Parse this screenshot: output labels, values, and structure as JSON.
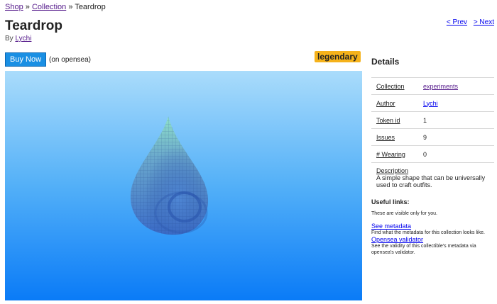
{
  "breadcrumb": {
    "shop": "Shop",
    "sep1": "»",
    "collection": "Collection",
    "sep2": "»",
    "current": "Teardrop"
  },
  "title": "Teardrop",
  "byline": {
    "prefix": "By",
    "author": "Lychi"
  },
  "pager": {
    "prev": "< Prev",
    "next": "> Next"
  },
  "buy": {
    "label": "Buy Now",
    "note": "(on opensea)"
  },
  "badge": {
    "label": "legendary",
    "color": "#f5b21b"
  },
  "viewer": {
    "icon": "teardrop-voxel-icon",
    "bg_top": "#aadcfb",
    "bg_bottom": "#0a7bf7"
  },
  "details": {
    "heading": "Details",
    "rows": [
      {
        "key": "Collection",
        "value": "experiments"
      },
      {
        "key": "Author",
        "value": "Lychi"
      },
      {
        "key": "Token id",
        "value": "1"
      },
      {
        "key": "Issues",
        "value": "9"
      },
      {
        "key": "# Wearing",
        "value": "0"
      }
    ],
    "description_key": "Description",
    "description": "A simple shape that can be universally used to craft outfits."
  },
  "useful": {
    "heading": "Useful links:",
    "subtitle": "These are visible only for you.",
    "links": [
      {
        "label": "See metadata",
        "desc": "Find what the metadata for this collection looks like."
      },
      {
        "label": "Opensea validator",
        "desc": "See the validity of this collectible's metadata via opensea's validator."
      }
    ]
  }
}
